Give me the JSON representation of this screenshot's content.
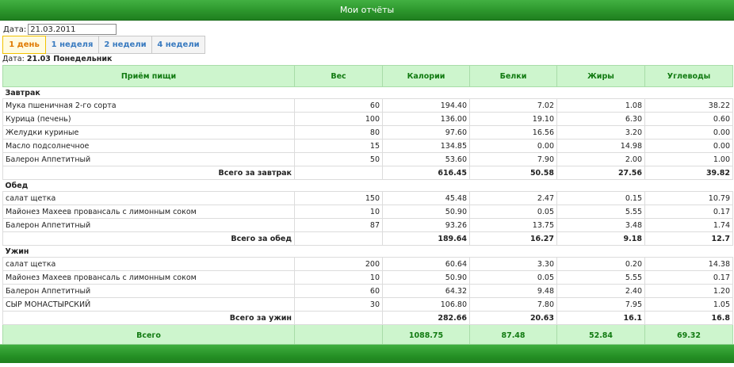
{
  "header": {
    "title": "Мои отчёты"
  },
  "date_filter": {
    "label": "Дата:",
    "value": "21.03.2011"
  },
  "tabs": [
    {
      "label": "1 день",
      "active": true
    },
    {
      "label": "1 неделя",
      "active": false
    },
    {
      "label": "2 недели",
      "active": false
    },
    {
      "label": "4 недели",
      "active": false
    }
  ],
  "day_heading": {
    "label": "Дата:",
    "value": "21.03 Понедельник"
  },
  "table": {
    "columns": [
      "Приём пищи",
      "Вес",
      "Калории",
      "Белки",
      "Жиры",
      "Углеводы"
    ],
    "meals": [
      {
        "name": "Завтрак",
        "items": [
          [
            "Мука пшеничная 2-го сорта",
            "60",
            "194.40",
            "7.02",
            "1.08",
            "38.22"
          ],
          [
            "Курица (печень)",
            "100",
            "136.00",
            "19.10",
            "6.30",
            "0.60"
          ],
          [
            "Желудки куриные",
            "80",
            "97.60",
            "16.56",
            "3.20",
            "0.00"
          ],
          [
            "Масло подсолнечное",
            "15",
            "134.85",
            "0.00",
            "14.98",
            "0.00"
          ],
          [
            "Балерон Аппетитный",
            "50",
            "53.60",
            "7.90",
            "2.00",
            "1.00"
          ]
        ],
        "subtotal": [
          "Всего за завтрак",
          "",
          "616.45",
          "50.58",
          "27.56",
          "39.82"
        ]
      },
      {
        "name": "Обед",
        "items": [
          [
            "салат щетка",
            "150",
            "45.48",
            "2.47",
            "0.15",
            "10.79"
          ],
          [
            "Майонез Махеев провансаль с лимонным соком",
            "10",
            "50.90",
            "0.05",
            "5.55",
            "0.17"
          ],
          [
            "Балерон Аппетитный",
            "87",
            "93.26",
            "13.75",
            "3.48",
            "1.74"
          ]
        ],
        "subtotal": [
          "Всего за обед",
          "",
          "189.64",
          "16.27",
          "9.18",
          "12.7"
        ]
      },
      {
        "name": "Ужин",
        "items": [
          [
            "салат щетка",
            "200",
            "60.64",
            "3.30",
            "0.20",
            "14.38"
          ],
          [
            "Майонез Махеев провансаль с лимонным соком",
            "10",
            "50.90",
            "0.05",
            "5.55",
            "0.17"
          ],
          [
            "Балерон Аппетитный",
            "60",
            "64.32",
            "9.48",
            "2.40",
            "1.20"
          ],
          [
            "СЫР МОНАСТЫРСКИЙ",
            "30",
            "106.80",
            "7.80",
            "7.95",
            "1.05"
          ]
        ],
        "subtotal": [
          "Всего за ужин",
          "",
          "282.66",
          "20.63",
          "16.1",
          "16.8"
        ]
      }
    ],
    "total": [
      "Всего",
      "",
      "1088.75",
      "87.48",
      "52.84",
      "69.32"
    ]
  }
}
